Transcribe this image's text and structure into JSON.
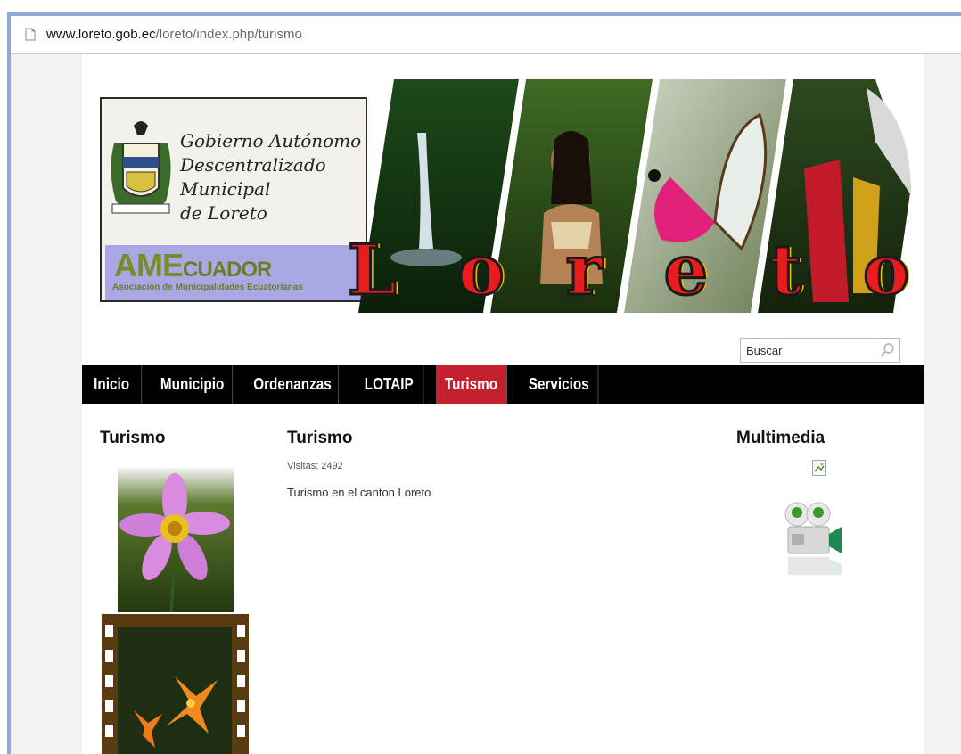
{
  "browser": {
    "url_host": "www.loreto.gob.ec",
    "url_path": "/loreto/index.php/turismo"
  },
  "banner": {
    "gov_lines": [
      "Gobierno Autónomo",
      "Descentralizado",
      "Municipal",
      "de Loreto"
    ],
    "ame_logo": "AME",
    "ame_logo_tail": "CUADOR",
    "ame_subtitle": "Asociación de Municipalidades Ecuatorianas",
    "word_letters": [
      "L",
      "o",
      "r",
      "e",
      "t",
      "o"
    ]
  },
  "search": {
    "placeholder": "Buscar"
  },
  "nav": {
    "items": [
      {
        "label": "Inicio"
      },
      {
        "label": "Municipio"
      },
      {
        "label": "Ordenanzas"
      },
      {
        "label": "LOTAIP"
      },
      {
        "label": "Turismo",
        "active": true
      },
      {
        "label": "Servicios"
      }
    ]
  },
  "left_column": {
    "heading": "Turismo"
  },
  "article": {
    "heading": "Turismo",
    "visits": "Visitas: 2492",
    "text": "Turismo en el canton Loreto"
  },
  "right_column": {
    "heading": "Multimedia"
  },
  "colors": {
    "nav_bg": "#000000",
    "nav_active": "#c4202e",
    "frame": "#8fa8d8"
  }
}
